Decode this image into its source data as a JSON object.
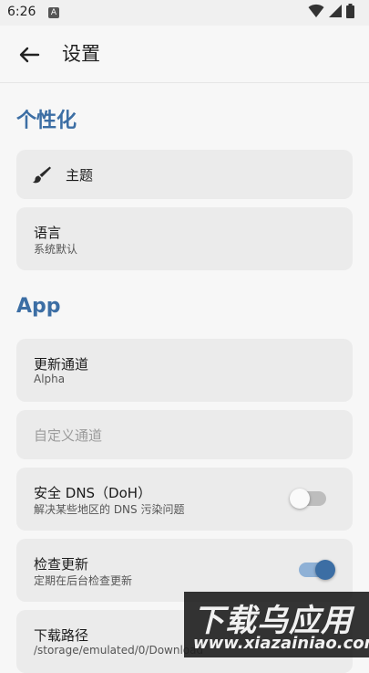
{
  "status_bar": {
    "time": "6:26",
    "app_badge": "A"
  },
  "app_bar": {
    "title": "设置"
  },
  "sections": [
    {
      "title": "个性化"
    },
    {
      "title": "App"
    }
  ],
  "items": {
    "theme": {
      "title": "主题",
      "icon": "brush-icon"
    },
    "language": {
      "title": "语言",
      "subtitle": "系统默认"
    },
    "update_channel": {
      "title": "更新通道",
      "subtitle": "Alpha"
    },
    "custom_channel": {
      "title": "自定义通道"
    },
    "secure_dns": {
      "title": "安全 DNS（DoH）",
      "subtitle": "解决某些地区的 DNS 污染问题",
      "enabled": false
    },
    "check_update": {
      "title": "检查更新",
      "subtitle": "定期在后台检查更新",
      "enabled": true
    },
    "download_path": {
      "title": "下载路径",
      "subtitle": "/storage/emulated/0/Download"
    }
  },
  "watermark": {
    "text": "下载乌应用",
    "url": "www.xiazainiao.com"
  },
  "colors": {
    "accent": "#3c6ea4",
    "card": "#ebebeb",
    "background": "#f7f7f7",
    "toggle_on": "#3c6ea4"
  }
}
